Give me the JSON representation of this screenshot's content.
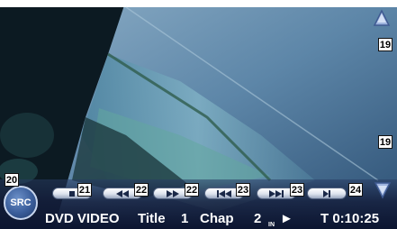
{
  "source_button": {
    "label": "SRC"
  },
  "callouts": {
    "up_arrow": "19",
    "down_arrow": "19",
    "src": "20",
    "stop": "21",
    "rewind": "22",
    "fast_forward": "22",
    "prev": "23",
    "next": "23",
    "slow": "24"
  },
  "status": {
    "source": "DVD VIDEO",
    "title_label": "Title",
    "title_number": "1",
    "chapter_label": "Chap",
    "chapter_number": "2",
    "in_label": "IN",
    "play_state": "►",
    "time": "T 0:10:25"
  },
  "colors": {
    "bar": "#0c1530",
    "button_face": "#ffffff",
    "arrow_blue": "#6a88c4"
  },
  "icons": {
    "stop": "stop-icon",
    "rewind": "rewind-icon",
    "fast_forward": "fast-forward-icon",
    "prev": "skip-back-icon",
    "next": "skip-forward-icon",
    "slow": "slow-play-icon",
    "up": "triangle-up-icon",
    "down": "triangle-down-icon"
  }
}
